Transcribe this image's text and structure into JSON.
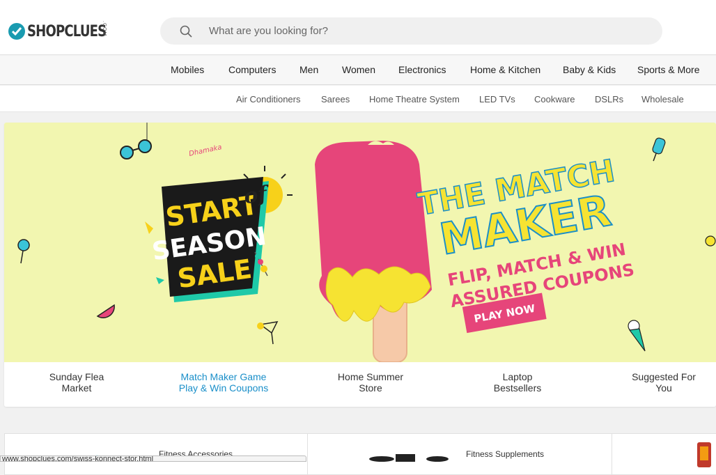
{
  "brand": {
    "name": "SHOPCLUES",
    "suffix": ".COM",
    "accent": "#1a9bb0"
  },
  "search": {
    "placeholder": "What are you looking for?"
  },
  "main_nav": [
    "Mobiles",
    "Computers",
    "Men",
    "Women",
    "Electronics",
    "Home & Kitchen",
    "Baby & Kids",
    "Sports & More"
  ],
  "sub_nav": [
    "Air Conditioners",
    "Sarees",
    "Home Theatre System",
    "LED TVs",
    "Cookware",
    "DSLRs",
    "Wholesale"
  ],
  "banner": {
    "doodle": "Dhamaka",
    "sale_start": "START",
    "sale_of": "of",
    "sale_season": "SEASON",
    "sale_sale": "SALE",
    "headline_1": "THE MATCH",
    "headline_2": "MAKER",
    "tagline_1": "FLIP, MATCH & WIN",
    "tagline_2": "ASSURED COUPONS",
    "cta": "PLAY NOW",
    "colors": {
      "background": "#f2f6b0",
      "pink": "#e6457a",
      "yellow": "#f6e332",
      "teal": "#1fc9a8"
    }
  },
  "banner_tabs": [
    {
      "line1": "Sunday Flea",
      "line2": "Market",
      "active": false
    },
    {
      "line1": "Match Maker Game",
      "line2": "Play & Win Coupons",
      "active": true
    },
    {
      "line1": "Home Summer",
      "line2": "Store",
      "active": false
    },
    {
      "line1": "Laptop",
      "line2": "Bestsellers",
      "active": false
    },
    {
      "line1": "Suggested For",
      "line2": "You",
      "active": false
    }
  ],
  "cards": [
    {
      "title": "Fitness Accessories"
    },
    {
      "title": "Fitness Supplements"
    }
  ],
  "status_url": "www.shopclues.com/swiss-konnect-stor.html"
}
